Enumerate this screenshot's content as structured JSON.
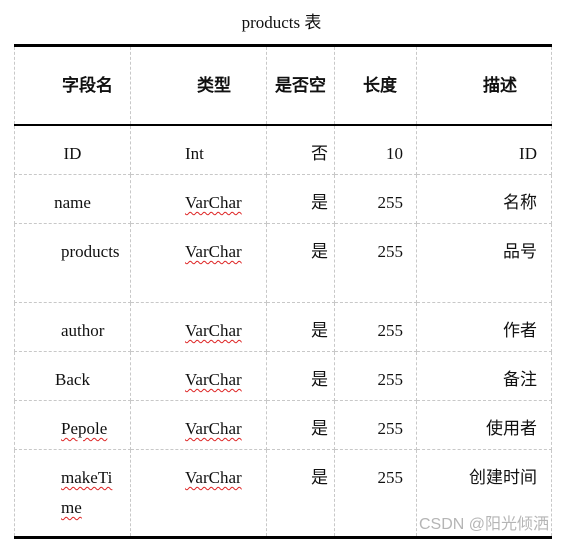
{
  "caption": "products 表",
  "table": {
    "headers": [
      "字段名",
      "类型",
      "是否空",
      "长度",
      "描述"
    ],
    "rows": [
      {
        "field": "ID",
        "type": "Int",
        "nullable": "否",
        "length": "10",
        "desc": "ID",
        "field_spell": false,
        "type_spell": false
      },
      {
        "field": "name",
        "type": "VarChar",
        "nullable": "是",
        "length": "255",
        "desc": "名称",
        "field_spell": false,
        "type_spell": true
      },
      {
        "field": "products",
        "type": "VarChar",
        "nullable": "是",
        "length": "255",
        "desc": "品号",
        "field_spell": false,
        "type_spell": true
      },
      {
        "field": "author",
        "type": "VarChar",
        "nullable": "是",
        "length": "255",
        "desc": "作者",
        "field_spell": false,
        "type_spell": true
      },
      {
        "field": "Back",
        "type": "VarChar",
        "nullable": "是",
        "length": "255",
        "desc": "备注",
        "field_spell": false,
        "type_spell": true
      },
      {
        "field": "Pepole",
        "type": "VarChar",
        "nullable": "是",
        "length": "255",
        "desc": "使用者",
        "field_spell": true,
        "type_spell": true
      },
      {
        "field": "makeTime",
        "type": "VarChar",
        "nullable": "是",
        "length": "255",
        "desc": "创建时间",
        "field_spell": true,
        "type_spell": true
      }
    ]
  },
  "watermark": "CSDN @阳光倾洒"
}
